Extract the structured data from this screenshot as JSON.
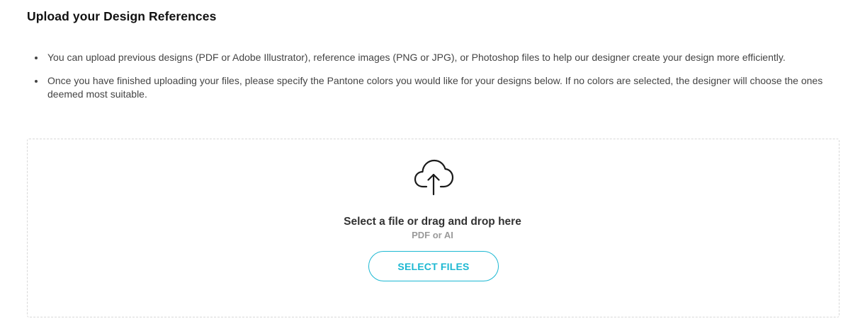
{
  "section": {
    "title": "Upload your Design References"
  },
  "instructions": [
    "You can upload previous designs (PDF or Adobe Illustrator), reference images (PNG or JPG), or Photoshop files to help our designer create your design more efficiently.",
    "Once you have finished uploading your files, please specify the Pantone colors you would like for your designs below. If no colors are selected, the designer will choose the ones deemed most suitable."
  ],
  "dropzone": {
    "icon": "cloud-upload-icon",
    "title": "Select a file or drag and drop here",
    "subtitle": "PDF or AI",
    "button_label": "SELECT FILES"
  },
  "colors": {
    "accent": "#1cb8d2",
    "text": "#333333",
    "muted": "#9a9a9a",
    "border": "#d8d8d8"
  }
}
